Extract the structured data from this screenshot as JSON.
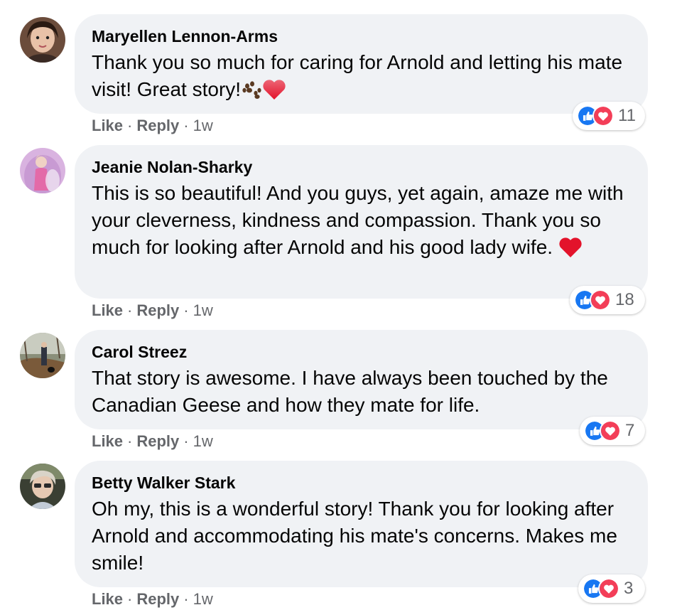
{
  "comments": [
    {
      "author": "Maryellen Lennon-Arms",
      "text": "Thank you so much for caring for Arnold and letting his mate visit! Great story!",
      "emoji": [
        "paw-prints",
        "red-heart"
      ],
      "actions": {
        "like": "Like",
        "reply": "Reply",
        "time": "1w"
      },
      "reaction_count": "11",
      "reactions": [
        "like-icon",
        "love-icon"
      ]
    },
    {
      "author": "Jeanie Nolan-Sharky",
      "text": "This is so beautiful! And you guys, yet again, amaze me with your cleverness, kindness and compassion. Thank you so much for looking after Arnold and his good lady wife.",
      "emoji": [
        "red-heart"
      ],
      "actions": {
        "like": "Like",
        "reply": "Reply",
        "time": "1w"
      },
      "reaction_count": "18",
      "reactions": [
        "like-icon",
        "love-icon"
      ]
    },
    {
      "author": "Carol Streez",
      "text": "That story is awesome. I have always been touched by the Canadian Geese and how they mate for life.",
      "actions": {
        "like": "Like",
        "reply": "Reply",
        "time": "1w"
      },
      "reaction_count": "7",
      "reactions": [
        "like-icon",
        "love-icon"
      ]
    },
    {
      "author": "Betty Walker Stark",
      "text": "Oh my, this is a wonderful story! Thank you for looking after Arnold and accommodating his mate's concerns. Makes me smile!",
      "actions": {
        "like": "Like",
        "reply": "Reply",
        "time": "1w"
      },
      "reaction_count": "3",
      "reactions": [
        "like-icon",
        "love-icon"
      ]
    }
  ],
  "colors": {
    "bubble": "#f0f2f5",
    "text": "#050505",
    "meta": "#65676b",
    "like_blue": "#1877f2",
    "love_red": "#f33e58"
  }
}
